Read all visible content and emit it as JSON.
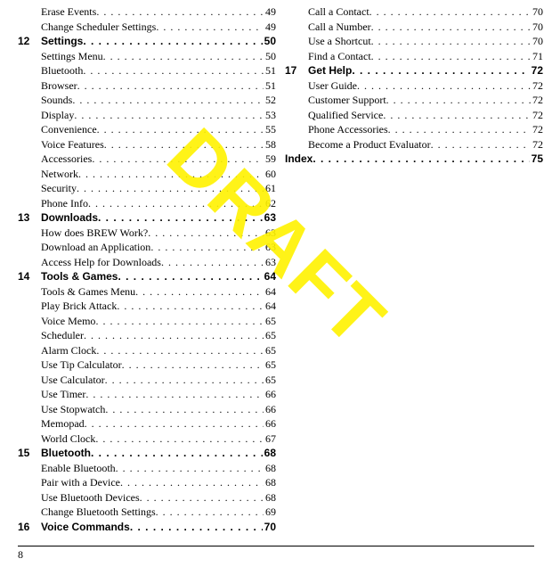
{
  "watermark": "DRAFT",
  "page_number": "8",
  "left_column": [
    {
      "type": "sub",
      "title": "Erase Events",
      "page": "49"
    },
    {
      "type": "sub",
      "title": "Change Scheduler Settings",
      "page": "49"
    },
    {
      "type": "chap",
      "num": "12",
      "title": "Settings",
      "page": "50"
    },
    {
      "type": "sub",
      "title": "Settings Menu",
      "page": "50"
    },
    {
      "type": "sub",
      "title": "Bluetooth",
      "page": "51"
    },
    {
      "type": "sub",
      "title": "Browser",
      "page": "51"
    },
    {
      "type": "sub",
      "title": "Sounds",
      "page": "52"
    },
    {
      "type": "sub",
      "title": "Display",
      "page": "53"
    },
    {
      "type": "sub",
      "title": "Convenience",
      "page": "55"
    },
    {
      "type": "sub",
      "title": "Voice Features",
      "page": "58"
    },
    {
      "type": "sub",
      "title": "Accessories",
      "page": "59"
    },
    {
      "type": "sub",
      "title": "Network",
      "page": "60"
    },
    {
      "type": "sub",
      "title": "Security",
      "page": "61"
    },
    {
      "type": "sub",
      "title": "Phone Info",
      "page": "62"
    },
    {
      "type": "chap",
      "num": "13",
      "title": "Downloads",
      "page": "63"
    },
    {
      "type": "sub",
      "title": "How does BREW Work?",
      "page": "63"
    },
    {
      "type": "sub",
      "title": "Download an Application",
      "page": "63"
    },
    {
      "type": "sub",
      "title": "Access Help for Downloads",
      "page": "63"
    },
    {
      "type": "chap",
      "num": "14",
      "title": "Tools & Games",
      "page": "64"
    },
    {
      "type": "sub",
      "title": "Tools & Games Menu",
      "page": "64"
    },
    {
      "type": "sub",
      "title": "Play Brick Attack",
      "page": "64"
    },
    {
      "type": "sub",
      "title": "Voice Memo",
      "page": "65"
    },
    {
      "type": "sub",
      "title": "Scheduler",
      "page": "65"
    },
    {
      "type": "sub",
      "title": "Alarm Clock",
      "page": "65"
    },
    {
      "type": "sub",
      "title": "Use Tip Calculator",
      "page": "65"
    },
    {
      "type": "sub",
      "title": "Use Calculator",
      "page": "65"
    },
    {
      "type": "sub",
      "title": "Use Timer",
      "page": "66"
    },
    {
      "type": "sub",
      "title": "Use Stopwatch",
      "page": "66"
    },
    {
      "type": "sub",
      "title": "Memopad",
      "page": "66"
    },
    {
      "type": "sub",
      "title": "World Clock",
      "page": "67"
    },
    {
      "type": "chap",
      "num": "15",
      "title": "Bluetooth",
      "page": "68"
    },
    {
      "type": "sub",
      "title": "Enable Bluetooth",
      "page": "68"
    },
    {
      "type": "sub",
      "title": "Pair with a Device",
      "page": "68"
    },
    {
      "type": "sub",
      "title": "Use Bluetooth Devices",
      "page": "68"
    },
    {
      "type": "sub",
      "title": "Change Bluetooth Settings",
      "page": "69"
    },
    {
      "type": "chap",
      "num": "16",
      "title": "Voice Commands",
      "page": "70"
    }
  ],
  "right_column": [
    {
      "type": "sub",
      "title": "Call a Contact",
      "page": "70"
    },
    {
      "type": "sub",
      "title": "Call a Number",
      "page": "70"
    },
    {
      "type": "sub",
      "title": "Use a Shortcut",
      "page": "70"
    },
    {
      "type": "sub",
      "title": "Find a Contact",
      "page": "71"
    },
    {
      "type": "chap",
      "num": "17",
      "title": "Get Help",
      "page": "72"
    },
    {
      "type": "sub",
      "title": "User Guide",
      "page": "72"
    },
    {
      "type": "sub",
      "title": "Customer Support",
      "page": "72"
    },
    {
      "type": "sub",
      "title": "Qualified Service",
      "page": "72"
    },
    {
      "type": "sub",
      "title": "Phone Accessories",
      "page": "72"
    },
    {
      "type": "sub",
      "title": "Become a Product Evaluator",
      "page": "72"
    },
    {
      "type": "index",
      "title": "Index",
      "page": "75"
    }
  ]
}
